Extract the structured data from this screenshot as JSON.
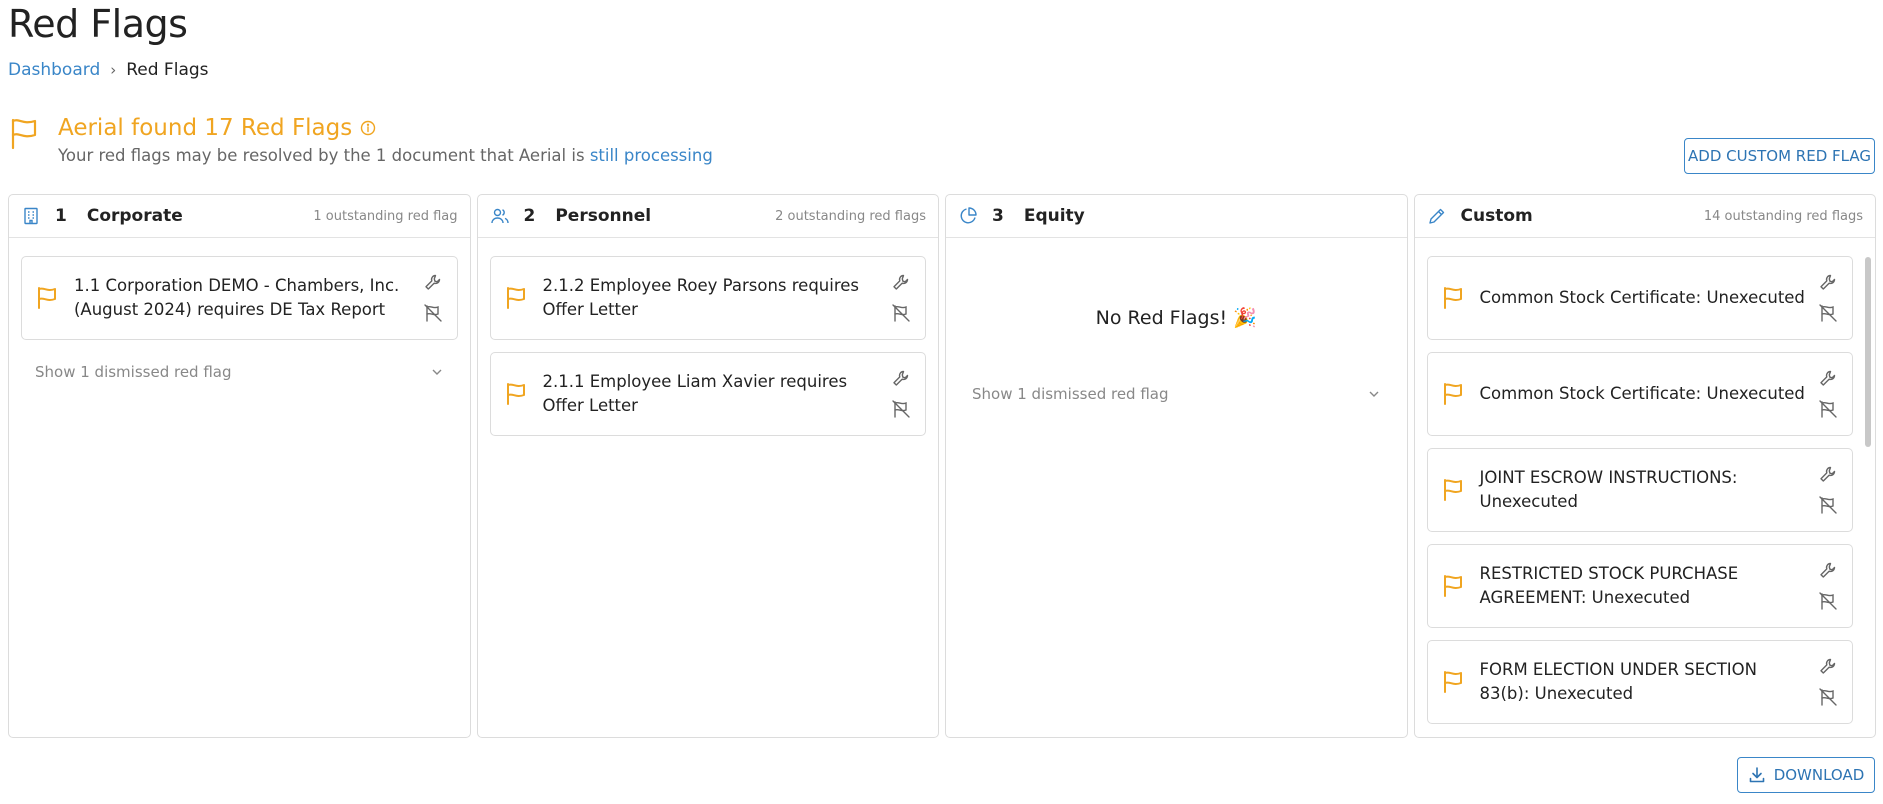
{
  "page": {
    "title": "Red Flags"
  },
  "breadcrumb": {
    "items": [
      {
        "label": "Dashboard"
      },
      {
        "label": "Red Flags"
      }
    ],
    "separator": "›"
  },
  "summary": {
    "title": "Aerial found 17 Red Flags",
    "subtitle_prefix": "Your red flags may be resolved by the 1 document that Aerial is ",
    "subtitle_link": "still processing"
  },
  "buttons": {
    "add_custom": "ADD CUSTOM RED FLAG",
    "download": "DOWNLOAD"
  },
  "colors": {
    "accent_orange": "#f0a521",
    "link_blue": "#3a86c8",
    "border": "#dcdcdc",
    "muted": "#888888"
  },
  "columns": [
    {
      "num": "1",
      "name": "Corporate",
      "icon": "building-icon",
      "count": "1 outstanding red flag",
      "cards": [
        {
          "text": "1.1 Corporation DEMO - Chambers, Inc. (August 2024) requires DE Tax Report"
        }
      ],
      "dismissed": "Show 1 dismissed red flag"
    },
    {
      "num": "2",
      "name": "Personnel",
      "icon": "users-icon",
      "count": "2 outstanding red flags",
      "cards": [
        {
          "text": "2.1.2 Employee Roey Parsons requires Offer Letter"
        },
        {
          "text": "2.1.1 Employee Liam Xavier requires Offer Letter"
        }
      ]
    },
    {
      "num": "3",
      "name": "Equity",
      "icon": "pie-chart-icon",
      "count": "",
      "empty": "No Red Flags! 🎉",
      "dismissed": "Show 1 dismissed red flag"
    },
    {
      "num": "",
      "name": "Custom",
      "icon": "pencil-icon",
      "count": "14 outstanding red flags",
      "cards": [
        {
          "text": "Common Stock Certificate: Unexecuted"
        },
        {
          "text": "Common Stock Certificate: Unexecuted"
        },
        {
          "text": "JOINT ESCROW INSTRUCTIONS: Unexecuted"
        },
        {
          "text": "RESTRICTED STOCK PURCHASE AGREEMENT: Unexecuted"
        },
        {
          "text": "FORM ELECTION UNDER SECTION 83(b): Unexecuted"
        }
      ]
    }
  ]
}
